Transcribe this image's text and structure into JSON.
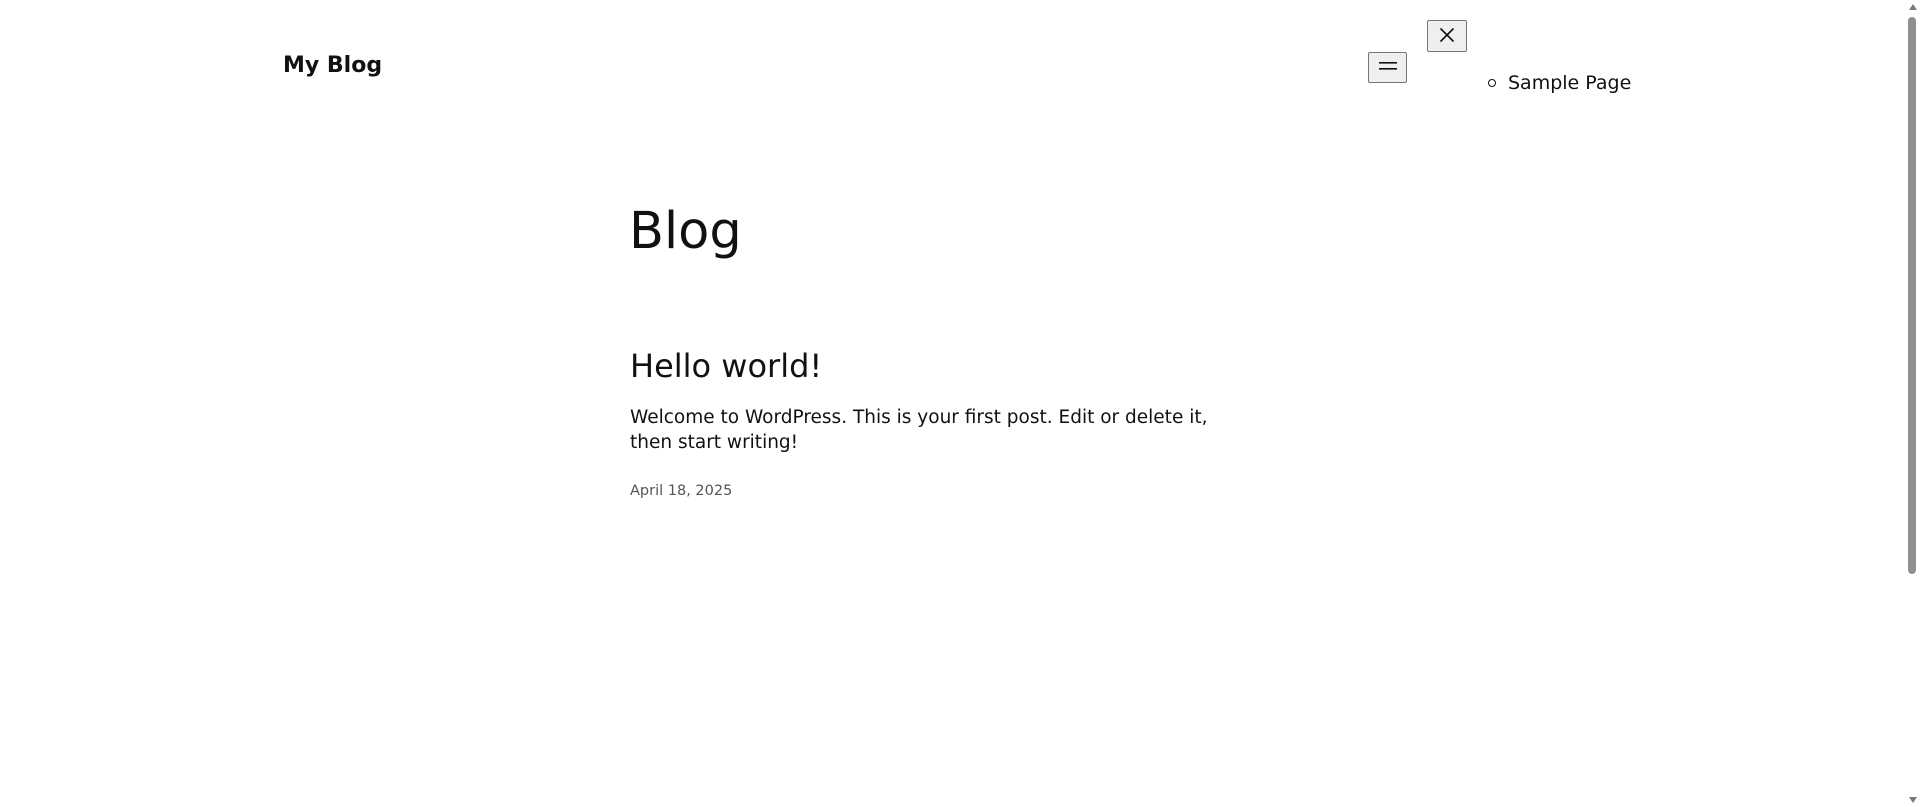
{
  "header": {
    "site_title": "My Blog",
    "open_menu_icon": "hamburger-icon",
    "close_menu_icon": "close-icon",
    "nav_items": [
      {
        "label": "Sample Page"
      }
    ]
  },
  "main": {
    "page_title": "Blog",
    "posts": [
      {
        "title": "Hello world!",
        "excerpt": "Welcome to WordPress. This is your first post. Edit or delete it, then start writing!",
        "date": "April 18, 2025"
      }
    ]
  }
}
